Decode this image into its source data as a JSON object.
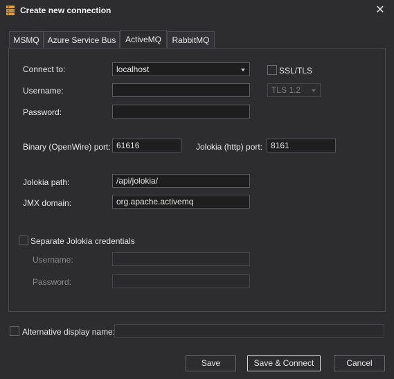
{
  "window": {
    "title": "Create new connection",
    "app_icon": "server-icon",
    "close_icon": "close-icon"
  },
  "tabs": [
    {
      "label": "MSMQ",
      "active": false
    },
    {
      "label": "Azure Service Bus",
      "active": false
    },
    {
      "label": "ActiveMQ",
      "active": true
    },
    {
      "label": "RabbitMQ",
      "active": false
    }
  ],
  "form": {
    "connect_to": {
      "label": "Connect to:",
      "value": "localhost"
    },
    "ssl": {
      "label": "SSL/TLS",
      "checked": false
    },
    "tls_version": {
      "value": "TLS 1.2",
      "enabled": false
    },
    "username": {
      "label": "Username:",
      "value": ""
    },
    "password": {
      "label": "Password:",
      "value": ""
    },
    "binary_port": {
      "label": "Binary (OpenWire) port:",
      "value": "61616"
    },
    "jolokia_port": {
      "label": "Jolokia (http) port:",
      "value": "8161"
    },
    "jolokia_path": {
      "label": "Jolokia path:",
      "value": "/api/jolokia/"
    },
    "jmx_domain": {
      "label": "JMX domain:",
      "value": "org.apache.activemq"
    },
    "separate_credentials": {
      "label": "Separate Jolokia credentials",
      "checked": false
    },
    "jolokia_username": {
      "label": "Username:",
      "value": "",
      "enabled": false
    },
    "jolokia_password": {
      "label": "Password:",
      "value": "",
      "enabled": false
    }
  },
  "alt_display_name": {
    "label": "Alternative display name:",
    "checked": false,
    "value": ""
  },
  "buttons": {
    "save": "Save",
    "save_connect": "Save & Connect",
    "cancel": "Cancel"
  }
}
